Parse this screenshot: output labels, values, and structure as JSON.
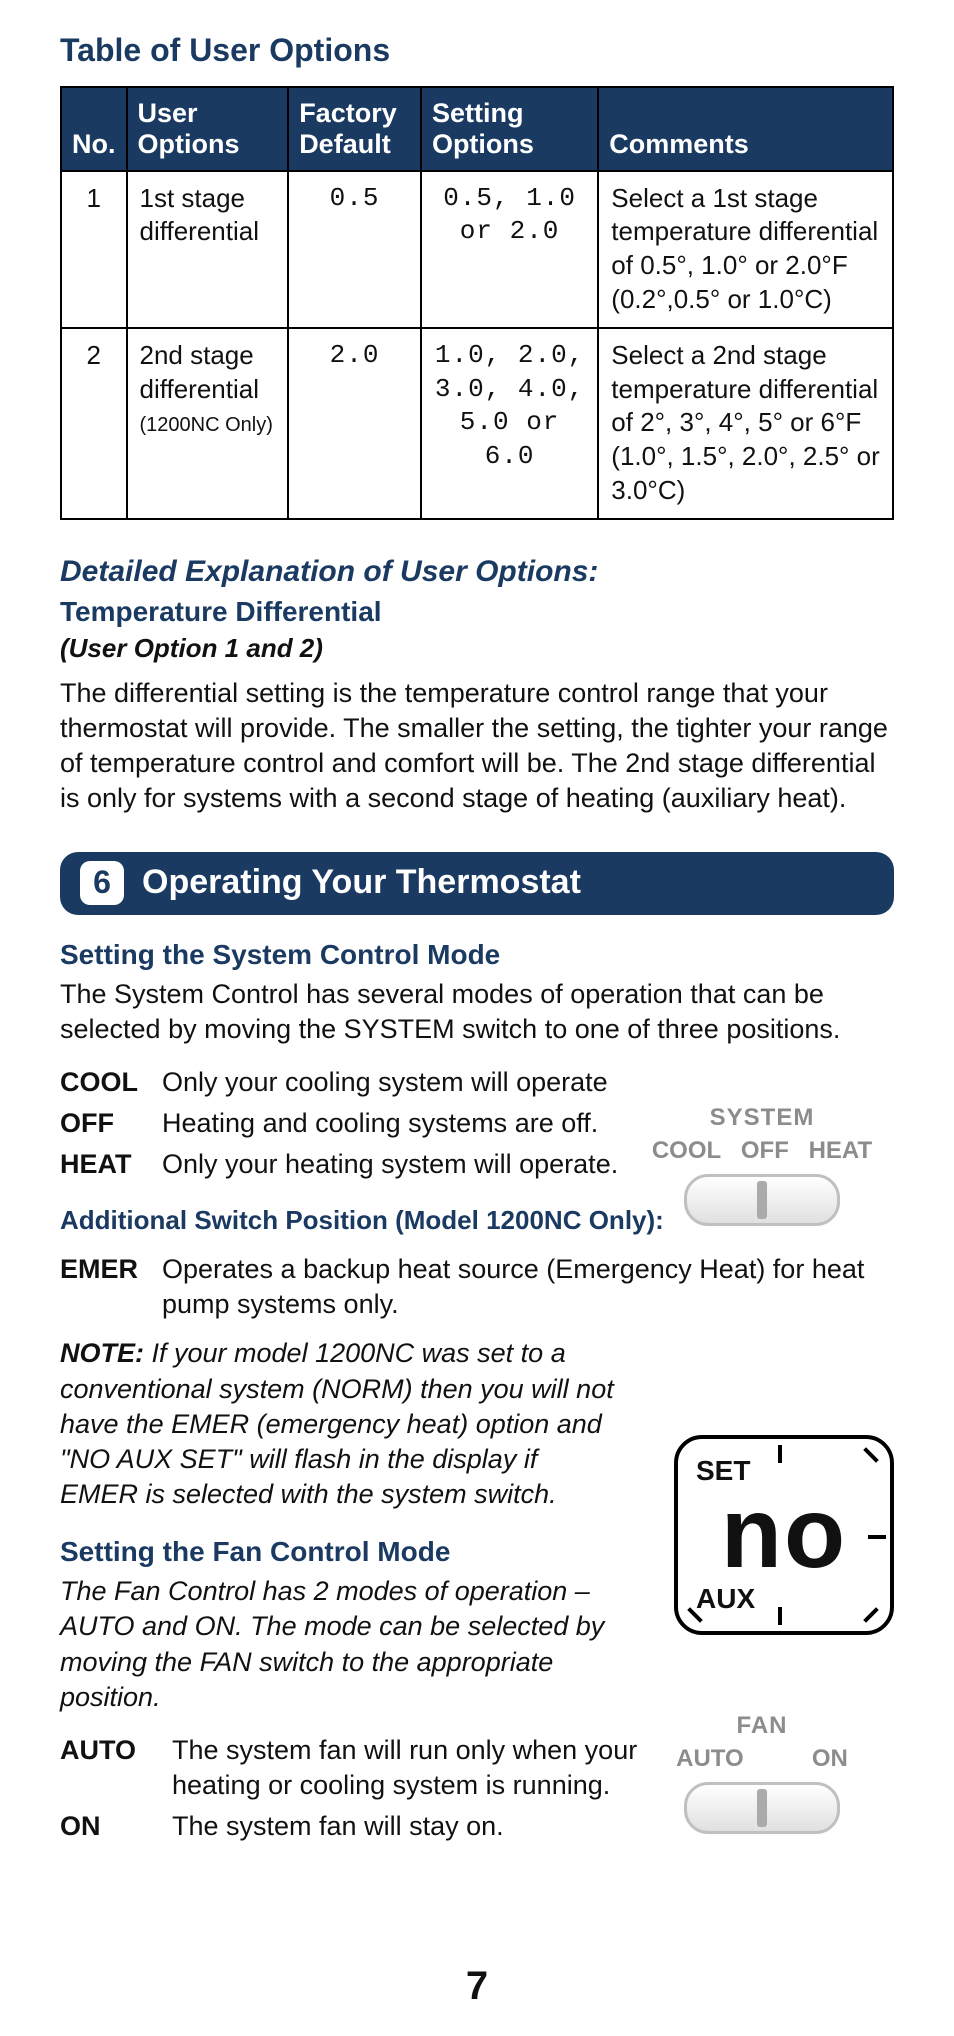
{
  "page_number": "7",
  "table_title": "Table of User Options",
  "table": {
    "headers": {
      "no": "No.",
      "user_options": "User Options",
      "factory_default": "Factory Default",
      "setting_options": "Setting Options",
      "comments": "Comments"
    },
    "rows": [
      {
        "no": "1",
        "user_option": "1st stage differential",
        "user_option_note": "",
        "factory": "0.5",
        "settings": "0.5, 1.0 or 2.0",
        "comments": "Select a 1st stage temperature differential of 0.5°, 1.0° or 2.0°F (0.2°,0.5° or 1.0°C)"
      },
      {
        "no": "2",
        "user_option": "2nd stage differential",
        "user_option_note": "(1200NC Only)",
        "factory": "2.0",
        "settings": "1.0, 2.0, 3.0, 4.0, 5.0 or 6.0",
        "comments": "Select a 2nd stage temperature differential of 2°, 3°, 4°, 5° or 6°F (1.0°, 1.5°, 2.0°, 2.5° or 3.0°C)"
      }
    ]
  },
  "detail_header": "Detailed Explanation of User Options:",
  "temp_diff_header": "Temperature Differential",
  "temp_diff_note": "(User Option 1 and 2)",
  "temp_diff_body": "The differential setting is the temperature control range that your thermostat will provide. The smaller the setting, the tighter your range of temperature control and comfort will be. The 2nd stage differential is only for systems with a second stage of heating (auxiliary heat).",
  "section": {
    "num": "6",
    "title": "Operating Your Thermostat"
  },
  "system_mode": {
    "heading": "Setting the System Control Mode",
    "intro": "The System Control has several modes of operation that can be selected by moving the SYSTEM switch to one of three positions.",
    "items": [
      {
        "term": "COOL",
        "text": "Only your cooling system will operate"
      },
      {
        "term": "OFF",
        "text": "Heating and cooling systems are off."
      },
      {
        "term": "HEAT",
        "text": "Only your heating system will operate."
      }
    ],
    "extra_heading": "Additional Switch Position (Model 1200NC Only):",
    "extra": {
      "term": "EMER",
      "text": "Operates a backup heat source (Emergency Heat) for heat pump systems only."
    },
    "note_label": "NOTE:",
    "note": " If your model 1200NC was set to a conventional system (NORM) then you will not have the EMER (emergency heat) option and \"NO AUX SET\" will flash in the display if EMER is selected with the system switch."
  },
  "system_switch": {
    "caption": "SYSTEM",
    "left": "COOL",
    "mid": "OFF",
    "right": "HEAT"
  },
  "lcd": {
    "top": "SET",
    "digits": "no",
    "bottom": "AUX"
  },
  "fan_mode": {
    "heading": "Setting the Fan Control Mode",
    "intro": "The Fan Control has 2 modes of operation – AUTO and ON. The mode can be selected by moving the FAN switch to the appropriate position.",
    "items": [
      {
        "term": "AUTO",
        "text": "The system fan will run only when your heating or cooling system is running."
      },
      {
        "term": "ON",
        "text": "The system fan will stay on."
      }
    ]
  },
  "fan_switch": {
    "caption": "FAN",
    "left": "AUTO",
    "right": "ON"
  }
}
